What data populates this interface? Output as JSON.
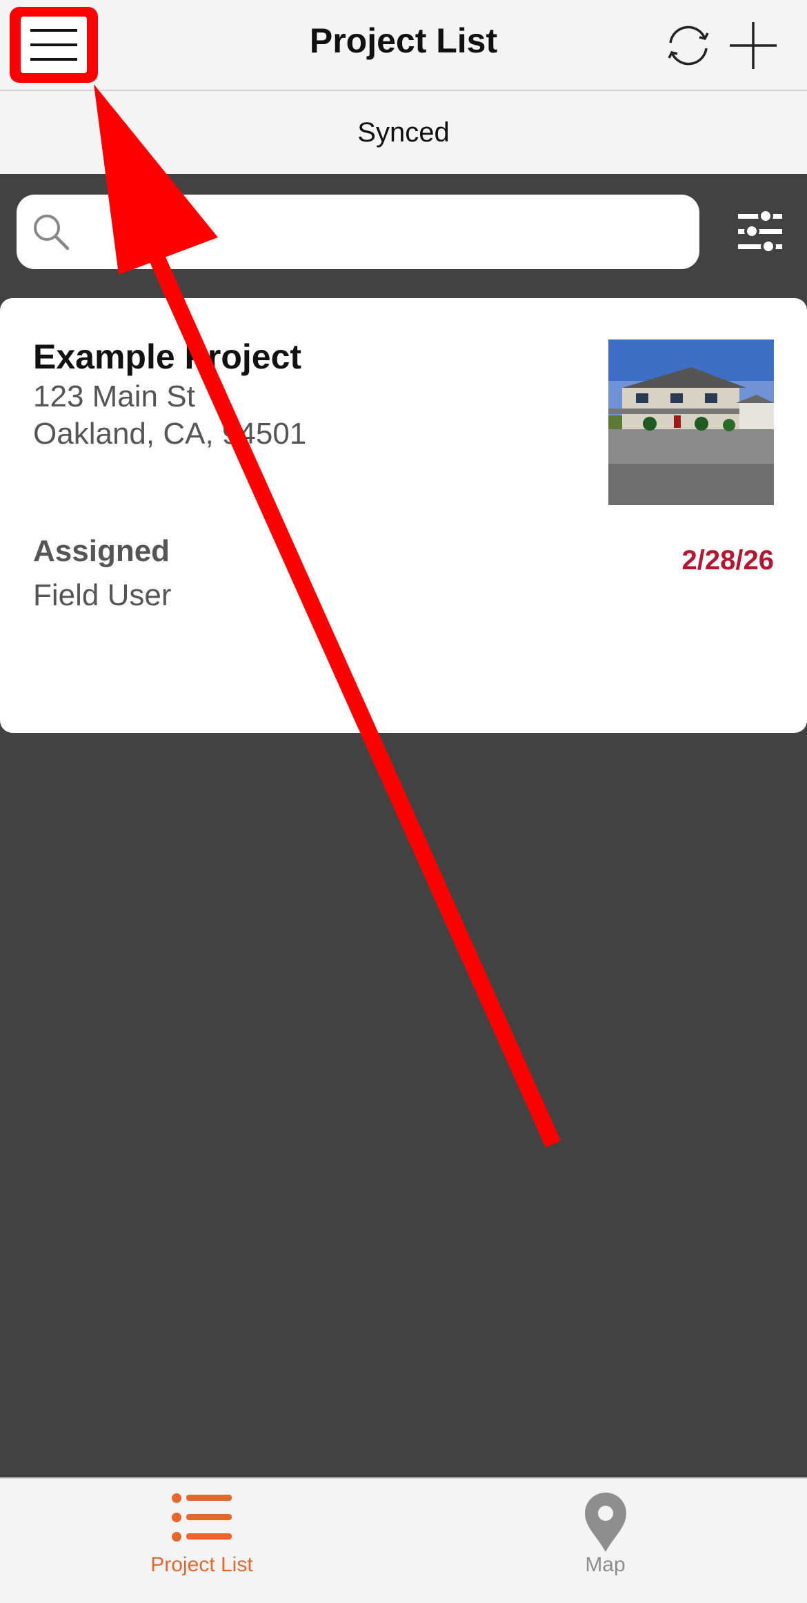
{
  "nav": {
    "title": "Project List"
  },
  "status": {
    "text": "Synced"
  },
  "search": {
    "placeholder": ""
  },
  "project": {
    "name": "Example Project",
    "address_line1": "123 Main St",
    "address_line2": "Oakland, CA, 94501",
    "assigned_label": "Assigned",
    "assigned_user": "Field User",
    "due_date": "2/28/26"
  },
  "tabs": [
    {
      "label": "Project List",
      "active": true,
      "icon": "list-icon"
    },
    {
      "label": "Map",
      "active": false,
      "icon": "map-pin-icon"
    }
  ],
  "colors": {
    "accent": "#e8662c",
    "due_date": "#b5152e",
    "annotation": "#ff0000",
    "background": "#424242"
  }
}
